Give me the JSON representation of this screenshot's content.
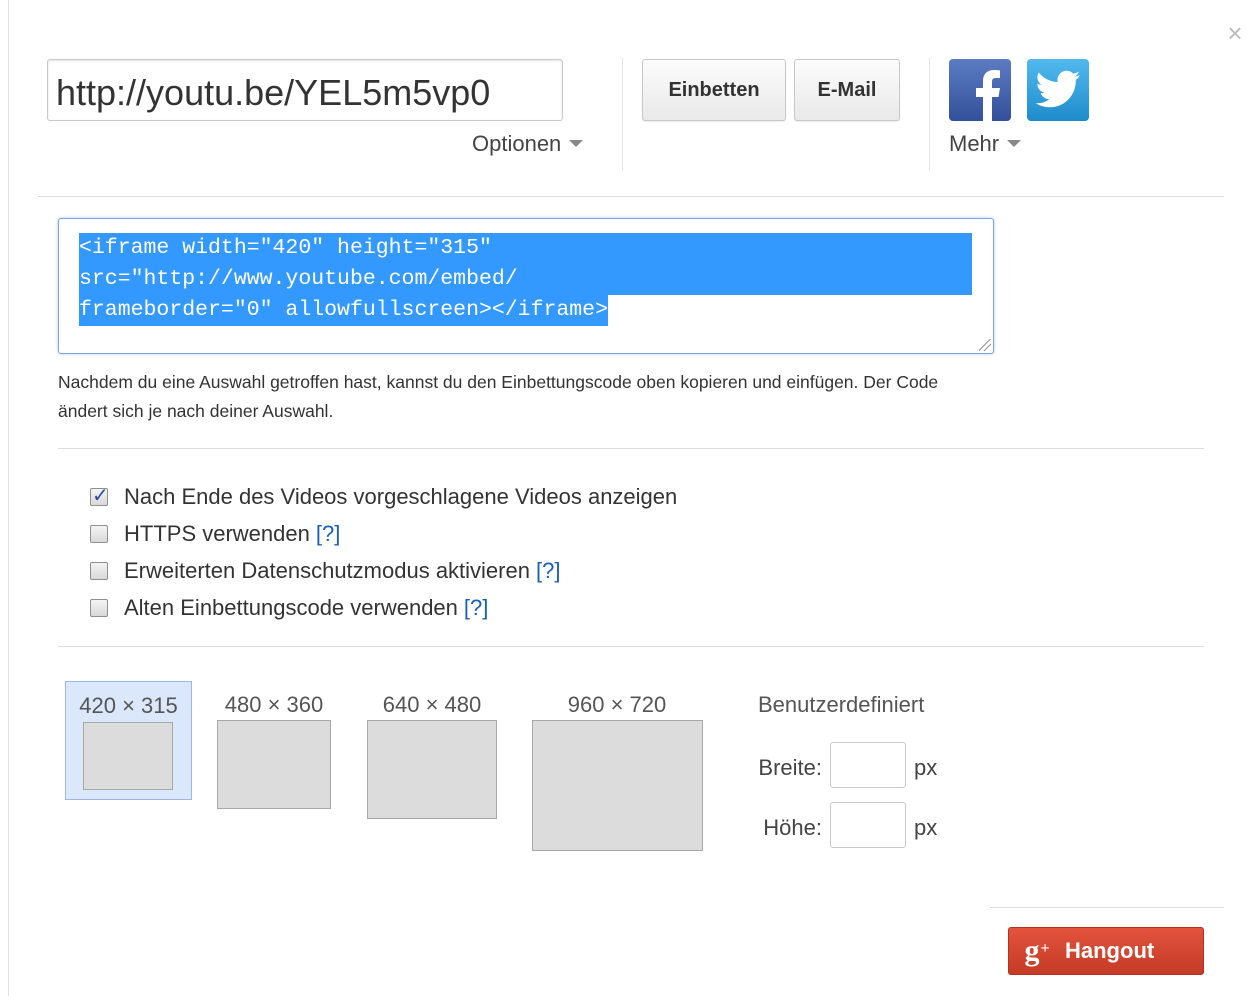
{
  "share": {
    "url": "http://youtu.be/YEL5m5vp0",
    "options_label": "Optionen",
    "embed_button": "Einbetten",
    "email_button": "E-Mail",
    "more_label": "Mehr",
    "facebook_icon": "facebook-icon",
    "twitter_icon": "twitter-icon",
    "close_icon": "close-icon"
  },
  "embed": {
    "code_lines": [
      "<iframe width=\"420\" height=\"315\"",
      "src=\"http://www.youtube.com/embed/",
      "frameborder=\"0\" allowfullscreen></iframe>"
    ],
    "help_text": "Nachdem du eine Auswahl getroffen hast, kannst du den Einbettungscode oben kopieren und einfügen. Der Code ändert sich je nach deiner Auswahl.",
    "selection_color": "#3399ff"
  },
  "options": [
    {
      "label": "Nach Ende des Videos vorgeschlagene Videos anzeigen",
      "checked": true,
      "help": ""
    },
    {
      "label": "HTTPS verwenden",
      "checked": false,
      "help": "[?]"
    },
    {
      "label": "Erweiterten Datenschutzmodus aktivieren",
      "checked": false,
      "help": "[?]"
    },
    {
      "label": "Alten Einbettungscode verwenden",
      "checked": false,
      "help": "[?]"
    }
  ],
  "sizes": [
    {
      "label": "420 × 315",
      "selected": true
    },
    {
      "label": "480 × 360",
      "selected": false
    },
    {
      "label": "640 × 480",
      "selected": false
    },
    {
      "label": "960 × 720",
      "selected": false
    }
  ],
  "custom_size": {
    "title": "Benutzerdefiniert",
    "width_label": "Breite:",
    "height_label": "Höhe:",
    "width_value": "",
    "height_value": "",
    "unit": "px"
  },
  "hangout": {
    "icon": "google-plus-icon",
    "label": "Hangout",
    "color": "#d4452f"
  }
}
